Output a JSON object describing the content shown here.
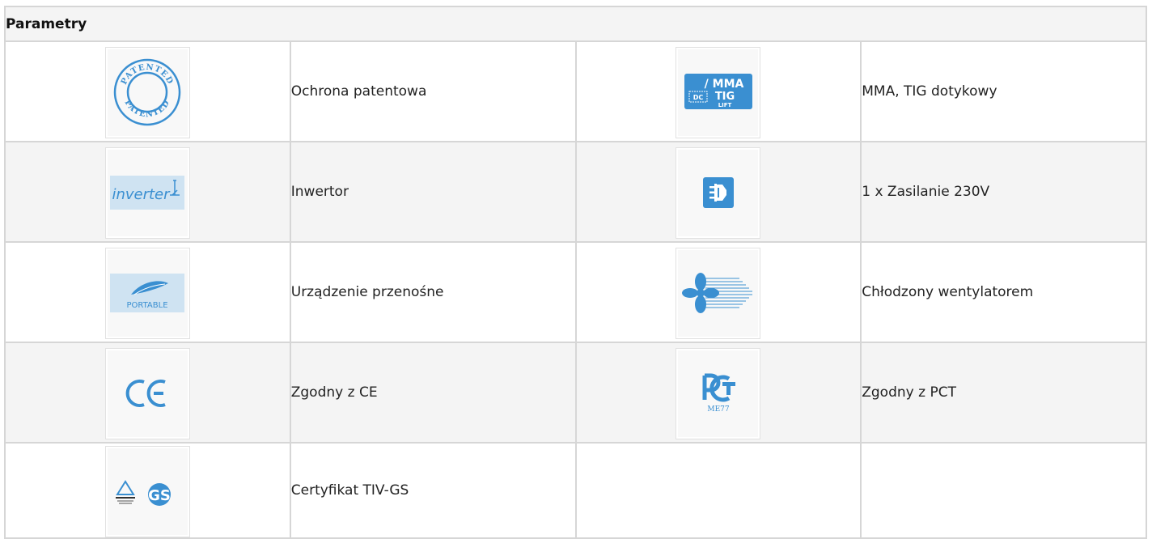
{
  "table": {
    "header": "Parametry",
    "rows": [
      {
        "left": {
          "icon": "patented-icon",
          "label": "Ochrona patentowa"
        },
        "right": {
          "icon": "mma-tig-icon",
          "label": "MMA, TIG dotykowy"
        }
      },
      {
        "left": {
          "icon": "inverter-icon",
          "label": "Inwertor"
        },
        "right": {
          "icon": "power-plug-icon",
          "label": "1 x Zasilanie 230V"
        }
      },
      {
        "left": {
          "icon": "portable-icon",
          "label": "Urządzenie przenośne"
        },
        "right": {
          "icon": "fan-cooling-icon",
          "label": "Chłodzony wentylatorem"
        }
      },
      {
        "left": {
          "icon": "ce-mark-icon",
          "label": "Zgodny z CE"
        },
        "right": {
          "icon": "pct-mark-icon",
          "label": "Zgodny z PCT"
        }
      },
      {
        "left": {
          "icon": "gs-cert-icon",
          "label": "Certyfikat TIV-GS"
        },
        "right": {
          "icon": "",
          "label": ""
        }
      }
    ]
  },
  "icon_texts": {
    "patented": "PATENTED",
    "mma": "/ MMA",
    "dc": "DC",
    "tig": "TIG",
    "lift": "LIFT",
    "inverter": "inverter",
    "portable": "PORTABLE",
    "ce": "CE",
    "pct": "PCT",
    "me77": "ME77",
    "gs": "GS"
  },
  "colors": {
    "icon_blue": "#3a8fd1",
    "border": "#d6d6d6",
    "header_bg": "#f4f4f4"
  }
}
